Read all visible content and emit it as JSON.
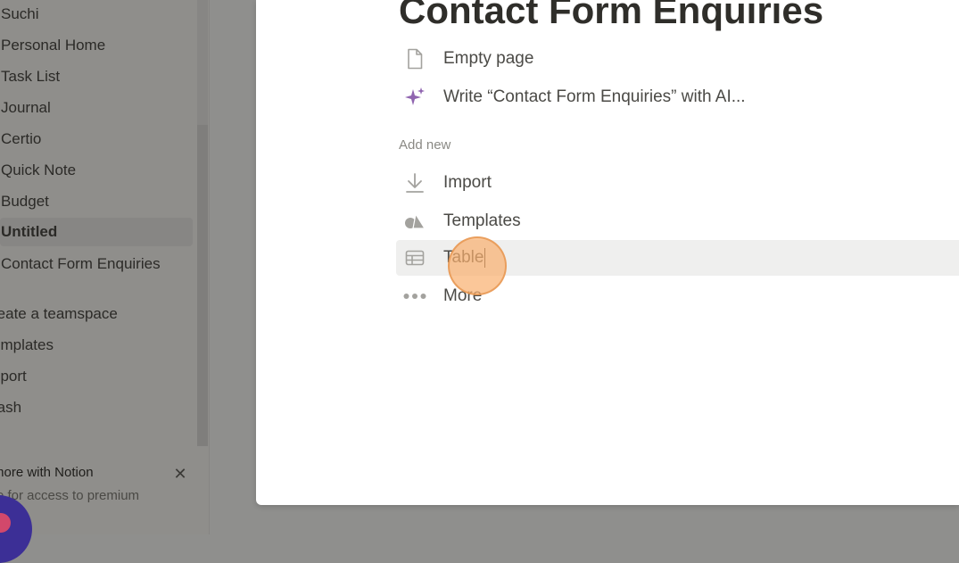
{
  "sidebar": {
    "items": [
      {
        "label": "Suchi"
      },
      {
        "label": "Personal Home"
      },
      {
        "label": "Task List"
      },
      {
        "label": "Journal"
      },
      {
        "label": "Certio"
      },
      {
        "label": "Quick Note"
      },
      {
        "label": "Budget"
      },
      {
        "label": "Untitled"
      },
      {
        "label": "Contact Form Enquiries"
      }
    ],
    "actions": [
      {
        "label": "reate a teamspace"
      },
      {
        "label": "emplates"
      },
      {
        "label": "nport"
      },
      {
        "label": "rash"
      }
    ],
    "promo": {
      "title": "more with Notion",
      "subtitle": "e for access to premium",
      "close_glyph": "✕"
    }
  },
  "modal": {
    "title": "Contact Form Enquiries",
    "options": [
      {
        "label": "Empty page",
        "icon": "page-icon"
      },
      {
        "label": "Write “Contact Form Enquiries” with AI...",
        "icon": "ai-sparkle-icon"
      }
    ],
    "add_new_label": "Add new",
    "add_new": [
      {
        "label": "Import",
        "icon": "import-icon"
      },
      {
        "label": "Templates",
        "icon": "templates-icon"
      },
      {
        "label": "Table",
        "icon": "table-icon"
      },
      {
        "label": "More",
        "icon": "more-icon"
      }
    ]
  },
  "colors": {
    "ai_accent": "#9065b0",
    "icon_gray": "#a3a29e",
    "click_marker": "#f5a96a",
    "avatar": "#3c2f96"
  }
}
